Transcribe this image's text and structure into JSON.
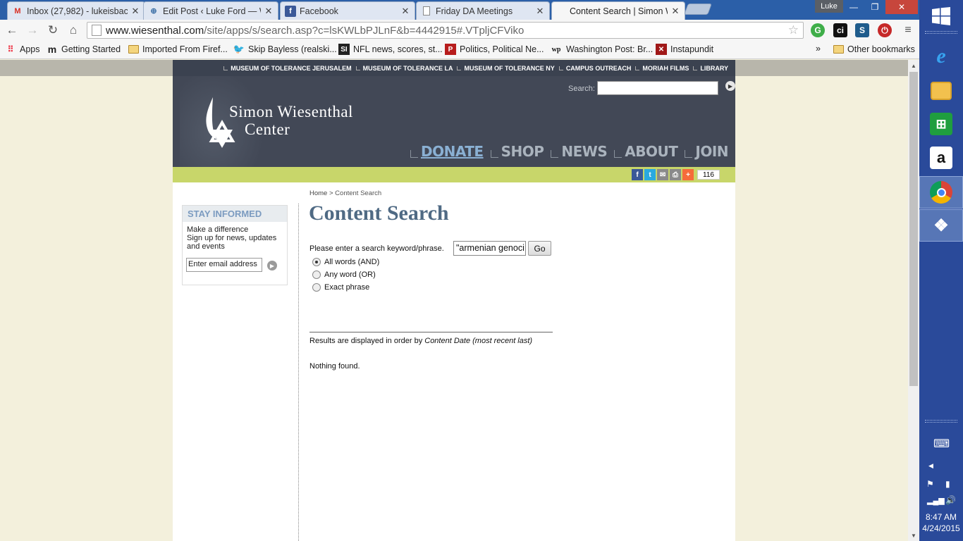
{
  "browser": {
    "tabs": [
      {
        "label": "Inbox (27,982) - lukeisbac",
        "favicon": "gmail-icon",
        "active": false
      },
      {
        "label": "Edit Post ‹ Luke Ford — W",
        "favicon": "wordpress-icon",
        "active": false
      },
      {
        "label": "Facebook",
        "favicon": "facebook-icon",
        "active": false
      },
      {
        "label": "Friday DA Meetings",
        "favicon": "page-icon",
        "active": false
      },
      {
        "label": "Content Search | Simon W",
        "favicon": "none",
        "active": true
      }
    ],
    "profile_name": "Luke",
    "url_host": "www.wiesenthal.com",
    "url_rest": "/site/apps/s/search.asp?c=lsKWLbPJLnF&b=4442915#.VTpljCFViko",
    "bookmarks": [
      {
        "label": "Apps",
        "icon": "apps-grid-icon"
      },
      {
        "label": "Getting Started",
        "icon": "m-logo-icon"
      },
      {
        "label": "Imported From Firef...",
        "icon": "folder-icon"
      },
      {
        "label": "Skip Bayless (realski...",
        "icon": "twitter-icon"
      },
      {
        "label": "NFL news, scores, st...",
        "icon": "si-icon"
      },
      {
        "label": "Politics, Political Ne...",
        "icon": "politico-icon"
      },
      {
        "label": "Washington Post: Br...",
        "icon": "wp-icon"
      },
      {
        "label": "Instapundit",
        "icon": "instapundit-icon"
      }
    ],
    "bookmarks_overflow": "»",
    "other_bookmarks": "Other bookmarks"
  },
  "site": {
    "top_links": [
      "MUSEUM OF TOLERANCE JERUSALEM",
      "MUSEUM OF TOLERANCE LA",
      "MUSEUM OF TOLERANCE NY",
      "CAMPUS OUTREACH",
      "MORIAH FILMS",
      "LIBRARY"
    ],
    "search_label": "Search:",
    "logo_line1": "Simon Wiesenthal",
    "logo_line2": "Center",
    "main_nav": [
      "DONATE",
      "SHOP",
      "NEWS",
      "ABOUT",
      "JOIN"
    ],
    "share_count": "116",
    "sidebar": {
      "title": "STAY INFORMED",
      "line1": "Make a difference",
      "line2": "Sign up for news, updates and events",
      "email_placeholder": "Enter email address"
    },
    "breadcrumb_home": "Home",
    "breadcrumb_sep": " > ",
    "breadcrumb_current": "Content Search",
    "page_title": "Content Search",
    "search_prompt": "Please enter a search keyword/phrase.",
    "search_value": "\"armenian genoci",
    "go_label": "Go",
    "options": [
      {
        "label": "All words (AND)",
        "selected": true
      },
      {
        "label": "Any word (OR)",
        "selected": false
      },
      {
        "label": "Exact phrase",
        "selected": false
      }
    ],
    "results_note_prefix": "Results are displayed in order by ",
    "results_note_order": "Content Date (most recent last)",
    "nothing_found": "Nothing found."
  },
  "taskbar": {
    "time": "8:47 AM",
    "date": "4/24/2015"
  }
}
